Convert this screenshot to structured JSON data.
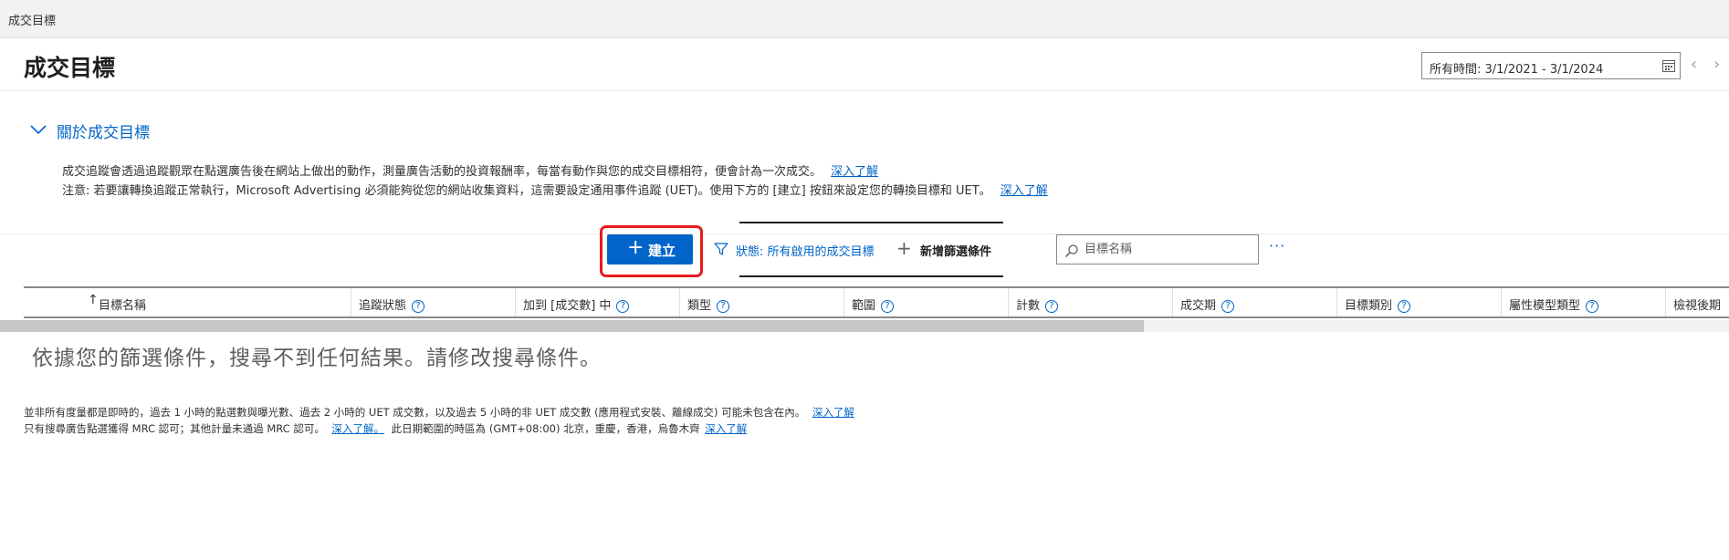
{
  "breadcrumb": {
    "label": "成交目標"
  },
  "header": {
    "title": "成交目標",
    "date_range": "所有時間: 3/1/2021 - 3/1/2024"
  },
  "about": {
    "toggle_label": "關於成交目標",
    "line1": "成交追蹤會透過追蹤觀眾在點選廣告後在網站上做出的動作，測量廣告活動的投資報酬率，每當有動作與您的成交目標相符，便會計為一次成交。",
    "line1_link": "深入了解",
    "line2": "注意: 若要讓轉換追蹤正常執行，Microsoft Advertising 必須能夠從您的網站收集資料，這需要設定通用事件追蹤 (UET)。使用下方的 [建立] 按鈕來設定您的轉換目標和 UET。",
    "line2_link": "深入了解"
  },
  "toolbar": {
    "create_label": "建立",
    "filter_label": "狀態: 所有啟用的成交目標",
    "add_filter_label": "新增篩選條件",
    "search_placeholder": "目標名稱",
    "more_label": "···"
  },
  "table": {
    "columns": [
      {
        "label": "目標名稱"
      },
      {
        "label": "追蹤狀態"
      },
      {
        "label": "加到 [成交數] 中"
      },
      {
        "label": "類型"
      },
      {
        "label": "範圍"
      },
      {
        "label": "計數"
      },
      {
        "label": "成交期"
      },
      {
        "label": "目標類別"
      },
      {
        "label": "屬性模型類型"
      },
      {
        "label": "檢視後期"
      }
    ],
    "empty_message": "依據您的篩選條件，搜尋不到任何結果。請修改搜尋條件。"
  },
  "footer": {
    "line1": "並非所有度量都是即時的，過去 1 小時的點選數與曝光數、過去 2 小時的 UET 成交數，以及過去 5 小時的非 UET 成交數 (應用程式安裝、離線成交) 可能未包含在內。",
    "line1_link": "深入了解",
    "line2a": "只有搜尋廣告點選獲得 MRC 認可；其他計量未通過 MRC 認可。",
    "line2a_link": "深入了解。",
    "line2b": "此日期範圍的時區為 (GMT+08:00) 北京，重慶，香港，烏魯木齊",
    "line2b_link": "深入了解"
  }
}
